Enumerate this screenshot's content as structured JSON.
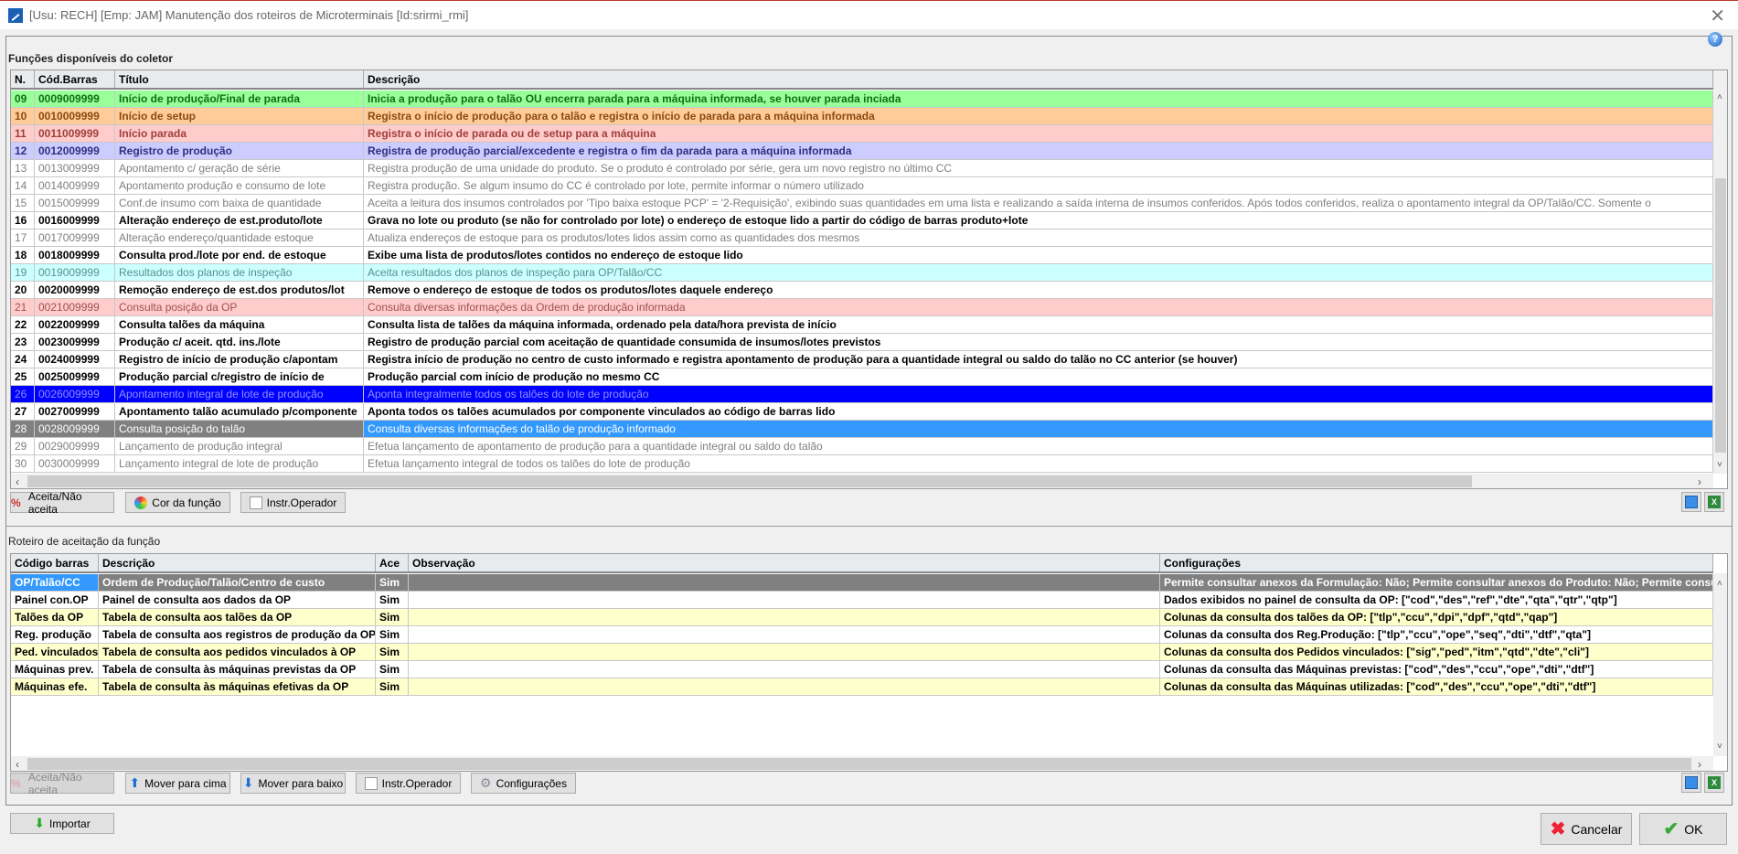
{
  "window": {
    "title": "[Usu: RECH] [Emp: JAM] Manutenção dos roteiros de Microterminais [Id:srirmi_rmi]"
  },
  "functions": {
    "label": "Funções disponíveis do coletor",
    "columns": [
      "N.",
      "Cód.Barras",
      "Título",
      "Descrição"
    ],
    "rows": [
      {
        "n": "09",
        "code": "0009009999",
        "title": "Início de produção/Final de parada",
        "desc": "Inicia a produção para o talão OU encerra parada para a máquina informada, se houver parada inciada",
        "style": "green"
      },
      {
        "n": "10",
        "code": "0010009999",
        "title": "Início de setup",
        "desc": "Registra o início de produção para o talão e registra o início de parada para a máquina informada",
        "style": "orange"
      },
      {
        "n": "11",
        "code": "0011009999",
        "title": "Início parada",
        "desc": "Registra o início de parada ou de setup para a máquina",
        "style": "pink"
      },
      {
        "n": "12",
        "code": "0012009999",
        "title": "Registro de produção",
        "desc": "Registra de produção parcial/excedente e registra o fim da parada para a máquina informada",
        "style": "lavender"
      },
      {
        "n": "13",
        "code": "0013009999",
        "title": "Apontamento c/ geração de série",
        "desc": "Registra produção de uma unidade do produto. Se o produto é controlado por série, gera um novo registro no último CC",
        "style": "gray"
      },
      {
        "n": "14",
        "code": "0014009999",
        "title": "Apontamento produção e consumo de lote",
        "desc": "Registra produção. Se algum insumo do CC é controlado por lote, permite informar o número utilizado",
        "style": "gray"
      },
      {
        "n": "15",
        "code": "0015009999",
        "title": "Conf.de insumo com baixa de quantidade",
        "desc": "Aceita a leitura dos insumos controlados por 'Tipo baixa estoque PCP' = '2-Requisição', exibindo suas quantidades em uma lista e realizando a saída interna de insumos conferidos. Após todos conferidos, realiza o apontamento integral da OP/Talão/CC. Somente o",
        "style": "gray"
      },
      {
        "n": "16",
        "code": "0016009999",
        "title": "Alteração endereço de est.produto/lote",
        "desc": "Grava no lote ou produto (se não for controlado por lote) o endereço de estoque lido a partir do código de barras produto+lote",
        "style": "bold"
      },
      {
        "n": "17",
        "code": "0017009999",
        "title": "Alteração endereço/quantidade estoque",
        "desc": "Atualiza endereços de estoque para os produtos/lotes lidos assim como as quantidades dos mesmos",
        "style": "gray"
      },
      {
        "n": "18",
        "code": "0018009999",
        "title": "Consulta prod./lote por end. de estoque",
        "desc": "Exibe uma lista de produtos/lotes contidos no endereço de estoque lido",
        "style": "bold"
      },
      {
        "n": "19",
        "code": "0019009999",
        "title": "Resultados dos planos de inspeção",
        "desc": "Aceita resultados dos planos de inspeção para OP/Talão/CC",
        "style": "cyan"
      },
      {
        "n": "20",
        "code": "0020009999",
        "title": "Remoção endereço de est.dos produtos/lot",
        "desc": "Remove o endereço de estoque de todos os produtos/lotes daquele endereço",
        "style": "bold"
      },
      {
        "n": "21",
        "code": "0021009999",
        "title": "Consulta posição da OP",
        "desc": "Consulta diversas informações da Ordem de produção informada",
        "style": "pink2"
      },
      {
        "n": "22",
        "code": "0022009999",
        "title": "Consulta talões da máquina",
        "desc": "Consulta lista de talões da máquina informada, ordenado pela data/hora prevista de início",
        "style": "bold"
      },
      {
        "n": "23",
        "code": "0023009999",
        "title": "Produção c/ aceit. qtd. ins./lote",
        "desc": "Registro de produção parcial com aceitação de quantidade consumida de insumos/lotes previstos",
        "style": "bold"
      },
      {
        "n": "24",
        "code": "0024009999",
        "title": "Registro de início de produção c/apontam",
        "desc": "Registra início de produção no centro de custo informado e registra apontamento de produção para a quantidade integral ou saldo do talão no CC anterior (se houver)",
        "style": "bold"
      },
      {
        "n": "25",
        "code": "0025009999",
        "title": "Produção parcial c/registro de início de",
        "desc": "Produção parcial com início de produção no mesmo CC",
        "style": "bold"
      },
      {
        "n": "26",
        "code": "0026009999",
        "title": "Apontamento integral de lote de produção",
        "desc": "Aponta integralmente todos os talões do lote de produção",
        "style": "blue"
      },
      {
        "n": "27",
        "code": "0027009999",
        "title": "Apontamento talão acumulado p/componente",
        "desc": "Aponta todos os talões acumulados por componente vinculados ao código de barras lido",
        "style": "bold"
      },
      {
        "n": "28",
        "code": "0028009999",
        "title": "Consulta posição do talão",
        "desc": "Consulta diversas informações do talão de produção informado",
        "style": "selected"
      },
      {
        "n": "29",
        "code": "0029009999",
        "title": "Lançamento de produção integral",
        "desc": "Efetua lançamento de apontamento de produção para a quantidade integral ou saldo do talão",
        "style": "gray"
      },
      {
        "n": "30",
        "code": "0030009999",
        "title": "Lançamento integral de lote de produção",
        "desc": "Efetua lançamento integral de todos os talões do lote de produção",
        "style": "gray"
      }
    ],
    "buttons": {
      "accept": "Aceita/Não aceita",
      "color": "Cor da função",
      "instr": "Instr.Operador"
    }
  },
  "route": {
    "label": "Roteiro de aceitação da função",
    "columns": [
      "Código barras",
      "Descrição",
      "Ace",
      "Observação",
      "Configurações"
    ],
    "rows": [
      {
        "code": "OP/Talão/CC",
        "desc": "Ordem de Produção/Talão/Centro de custo",
        "ace": "Sim",
        "obs": "",
        "config": "Permite consultar anexos da Formulação: Não; Permite consultar anexos do Produto: Não; Permite consu"
      },
      {
        "code": "Painel con.OP",
        "desc": "Painel de consulta aos dados da OP",
        "ace": "Sim",
        "obs": "",
        "config": "Dados exibidos no painel de consulta da OP: [\"cod\",\"des\",\"ref\",\"dte\",\"qta\",\"qtr\",\"qtp\"]"
      },
      {
        "code": "Talões da OP",
        "desc": "Tabela de consulta aos talões da OP",
        "ace": "Sim",
        "obs": "",
        "config": "Colunas da consulta dos talões da OP: [\"tlp\",\"ccu\",\"dpi\",\"dpf\",\"qtd\",\"qap\"]"
      },
      {
        "code": "Reg. produção",
        "desc": "Tabela de consulta aos registros de produção da OP",
        "ace": "Sim",
        "obs": "",
        "config": "Colunas da consulta dos Reg.Produção: [\"tlp\",\"ccu\",\"ope\",\"seq\",\"dti\",\"dtf\",\"qta\"]"
      },
      {
        "code": "Ped. vinculados",
        "desc": "Tabela de consulta aos pedidos vinculados à OP",
        "ace": "Sim",
        "obs": "",
        "config": "Colunas da consulta dos Pedidos vinculados: [\"sig\",\"ped\",\"itm\",\"qtd\",\"dte\",\"cli\"]"
      },
      {
        "code": "Máquinas prev.",
        "desc": "Tabela de consulta às máquinas previstas da OP",
        "ace": "Sim",
        "obs": "",
        "config": "Colunas da consulta das Máquinas previstas: [\"cod\",\"des\",\"ccu\",\"ope\",\"dti\",\"dtf\"]"
      },
      {
        "code": "Máquinas efe.",
        "desc": "Tabela de consulta às máquinas efetivas da OP",
        "ace": "Sim",
        "obs": "",
        "config": "Colunas da consulta das Máquinas utilizadas: [\"cod\",\"des\",\"ccu\",\"ope\",\"dti\",\"dtf\"]"
      }
    ],
    "buttons": {
      "accept": "Aceita/Não aceita",
      "up": "Mover para cima",
      "down": "Mover para baixo",
      "instr": "Instr.Operador",
      "config": "Configurações"
    }
  },
  "footer": {
    "import": "Importar",
    "cancel": "Cancelar",
    "ok": "OK"
  },
  "colors": {
    "green": "#99ff99",
    "orange": "#ffcc99",
    "pink": "#ffcccc",
    "lavender": "#ccccff",
    "cyan": "#ccffff",
    "blue": "#0000ff",
    "selected_gray": "#808080",
    "selected_blue": "#3399ff",
    "alt_yellow": "#ffffcc"
  }
}
